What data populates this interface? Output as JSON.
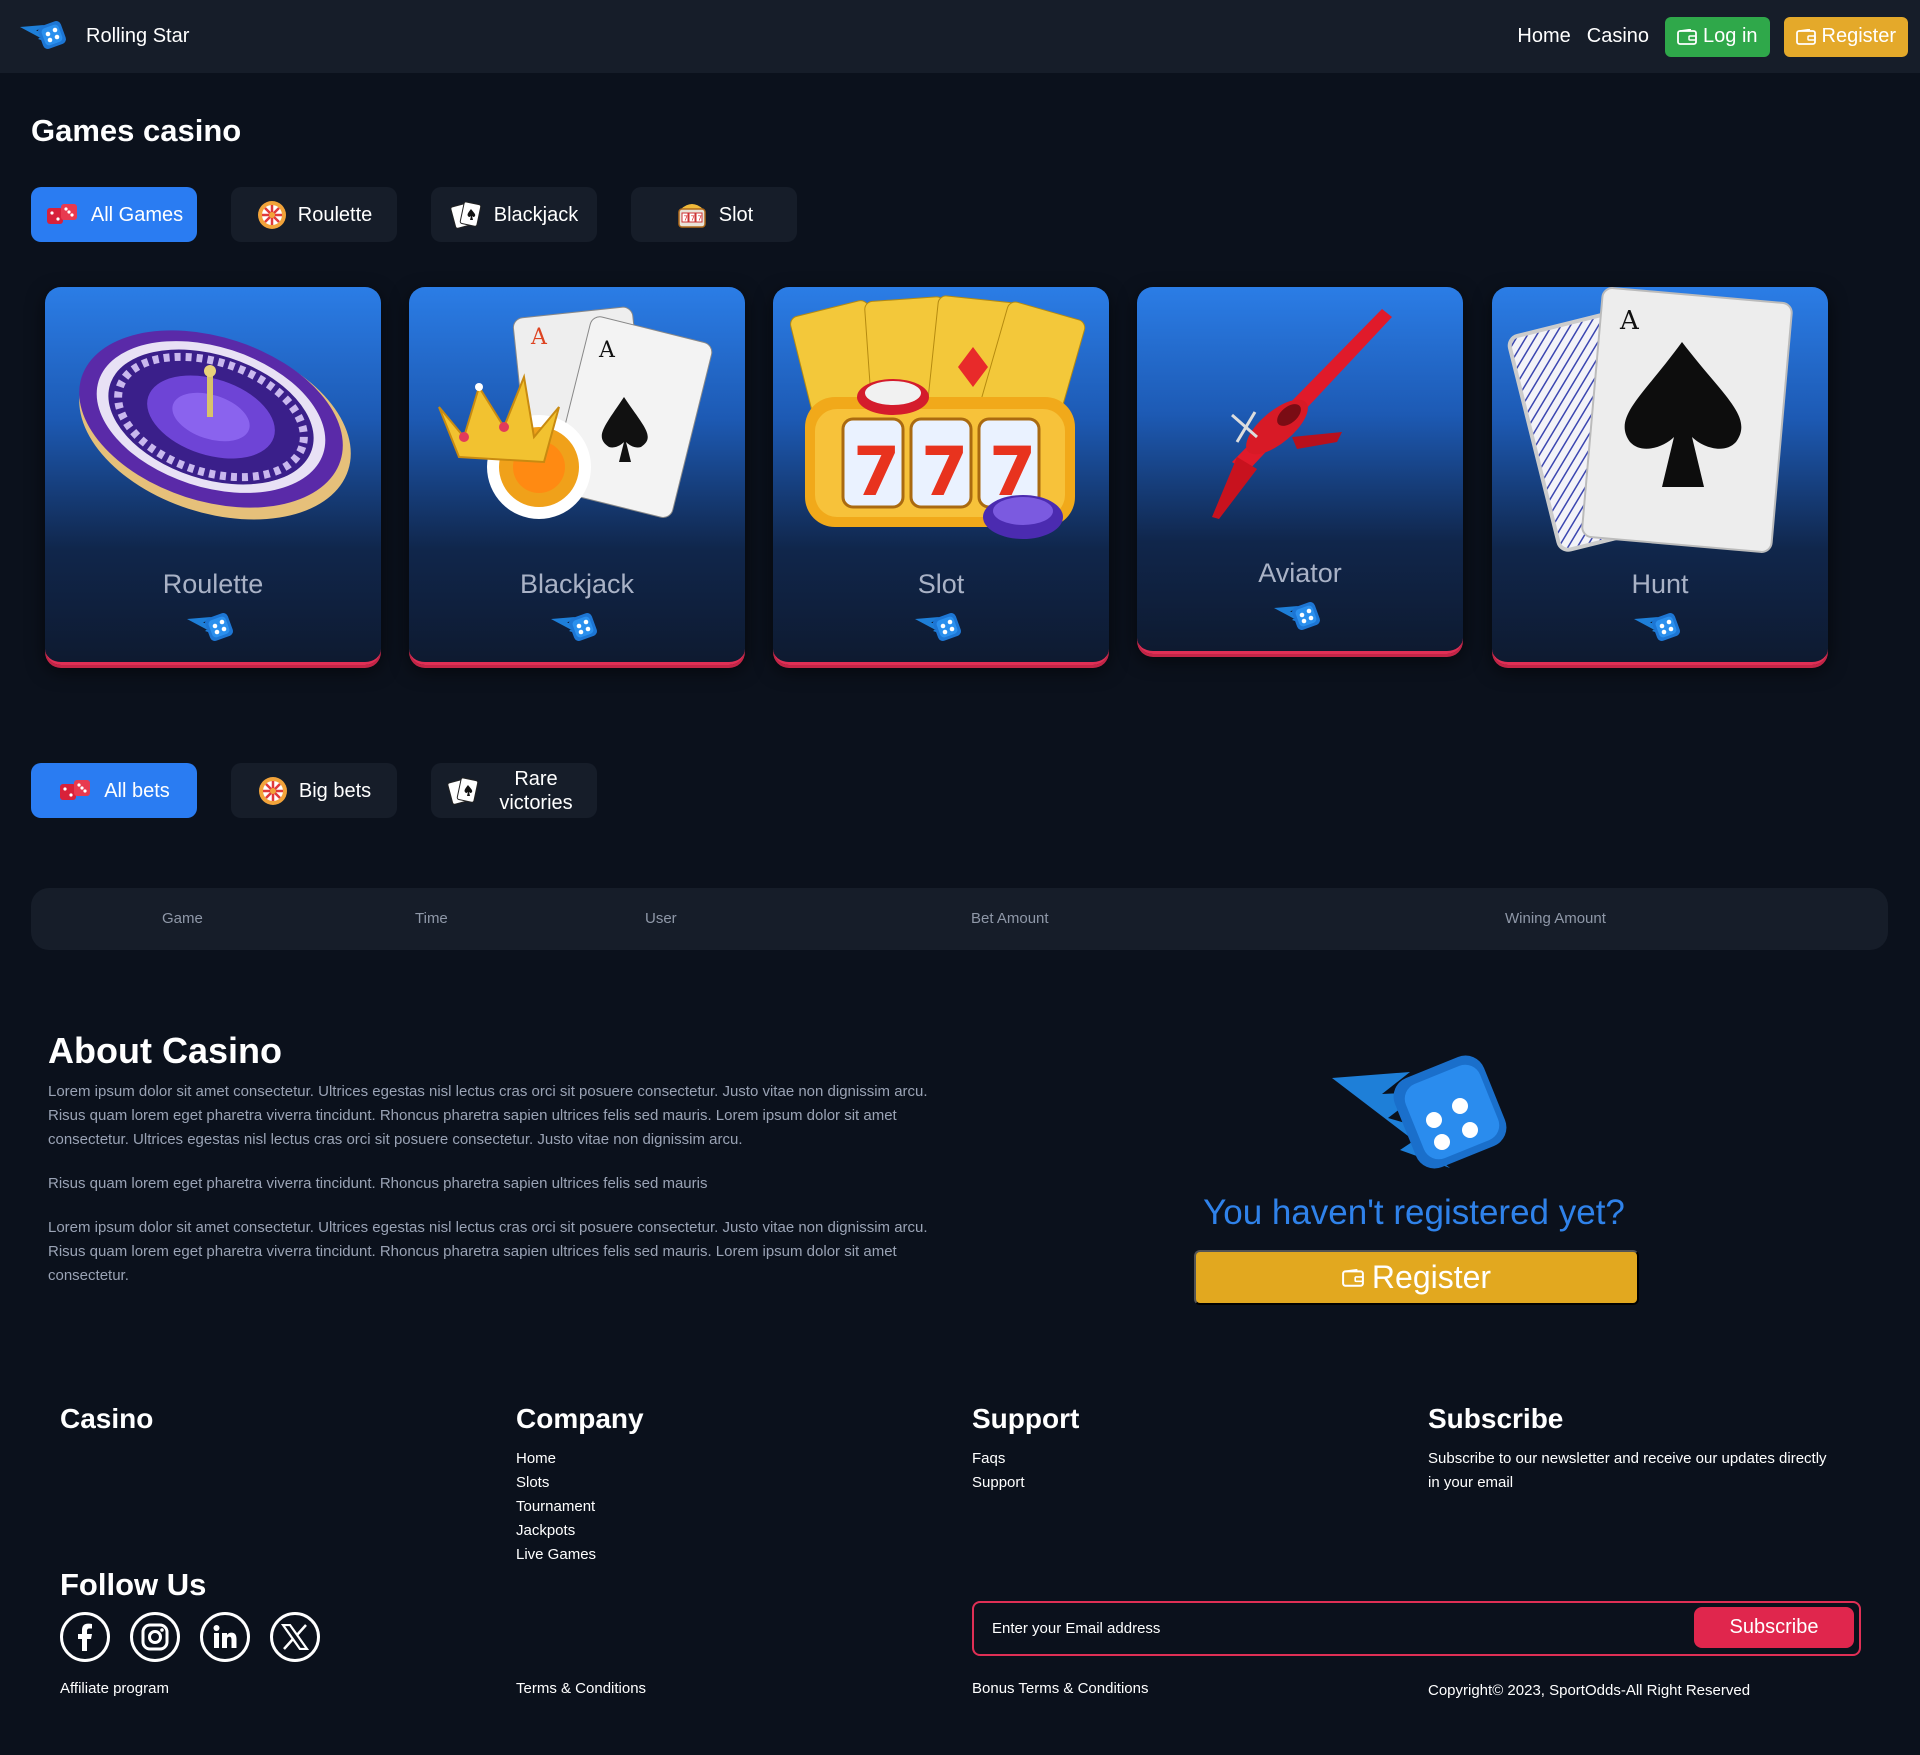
{
  "header": {
    "brand": "Rolling Star",
    "nav": {
      "home": "Home",
      "casino": "Casino"
    },
    "login_label": "Log in",
    "register_label": "Register"
  },
  "games_section": {
    "title": "Games casino",
    "tabs": [
      {
        "label": "All Games",
        "icon": "dice-icon",
        "active": true
      },
      {
        "label": "Roulette",
        "icon": "roulette-wheel-icon",
        "active": false
      },
      {
        "label": "Blackjack",
        "icon": "cards-icon",
        "active": false
      },
      {
        "label": "Slot",
        "icon": "slot-machine-icon",
        "active": false
      }
    ],
    "cards": [
      {
        "label": "Roulette",
        "art": "roulette-wheel"
      },
      {
        "label": "Blackjack",
        "art": "cards-crown-chip"
      },
      {
        "label": "Slot",
        "art": "slot-777"
      },
      {
        "label": "Aviator",
        "art": "red-plane"
      },
      {
        "label": "Hunt",
        "art": "ace-of-spades"
      }
    ]
  },
  "bets_section": {
    "tabs": [
      {
        "label": "All bets",
        "icon": "dice-icon",
        "active": true
      },
      {
        "label": "Big bets",
        "icon": "roulette-wheel-icon",
        "active": false
      },
      {
        "label": "Rare victories",
        "icon": "cards-icon",
        "active": false
      }
    ],
    "columns": [
      "Game",
      "Time",
      "User",
      "Bet Amount",
      "Wining Amount"
    ]
  },
  "about": {
    "title": "About Casino",
    "paragraphs": [
      "Lorem ipsum dolor sit amet consectetur. Ultrices egestas nisl lectus cras orci sit posuere consectetur. Justo vitae non dignissim arcu. Risus quam lorem eget pharetra viverra tincidunt. Rhoncus pharetra sapien ultrices felis sed mauris. Lorem ipsum dolor sit amet consectetur. Ultrices egestas nisl lectus cras orci sit posuere consectetur. Justo vitae non dignissim arcu.",
      "Risus quam lorem eget pharetra viverra tincidunt. Rhoncus pharetra sapien ultrices felis sed mauris",
      "Lorem ipsum dolor sit amet consectetur. Ultrices egestas nisl lectus cras orci sit posuere consectetur. Justo vitae non dignissim arcu. Risus quam lorem eget pharetra viverra tincidunt. Rhoncus pharetra sapien ultrices felis sed mauris. Lorem ipsum dolor sit amet consectetur."
    ],
    "promo_text": "You haven't registered yet?",
    "promo_button": "Register"
  },
  "footer": {
    "casino_title": "Casino",
    "company_title": "Company",
    "company_links": [
      "Home",
      "Slots",
      "Tournament",
      "Jackpots",
      "Live Games"
    ],
    "support_title": "Support",
    "support_links": [
      "Faqs",
      "Support"
    ],
    "subscribe_title": "Subscribe",
    "subscribe_desc": "Subscribe to our newsletter and receive our updates directly in your email",
    "follow_title": "Follow Us",
    "socials": [
      "facebook-icon",
      "instagram-icon",
      "linkedin-icon",
      "x-icon"
    ],
    "email_placeholder": "Enter your Email address",
    "subscribe_button": "Subscribe",
    "affiliate": "Affiliate program",
    "terms": "Terms & Conditions",
    "bonus_terms": "Bonus Terms & Conditions",
    "copyright": "Copyright© 2023, SportOdds-All Right Reserved"
  },
  "colors": {
    "background": "#0b111c",
    "panel": "#161d29",
    "accent_blue": "#2a7cf2",
    "login_green": "#2fa84a",
    "register_gold": "#e4a92a",
    "subscribe_red": "#e0264d"
  }
}
